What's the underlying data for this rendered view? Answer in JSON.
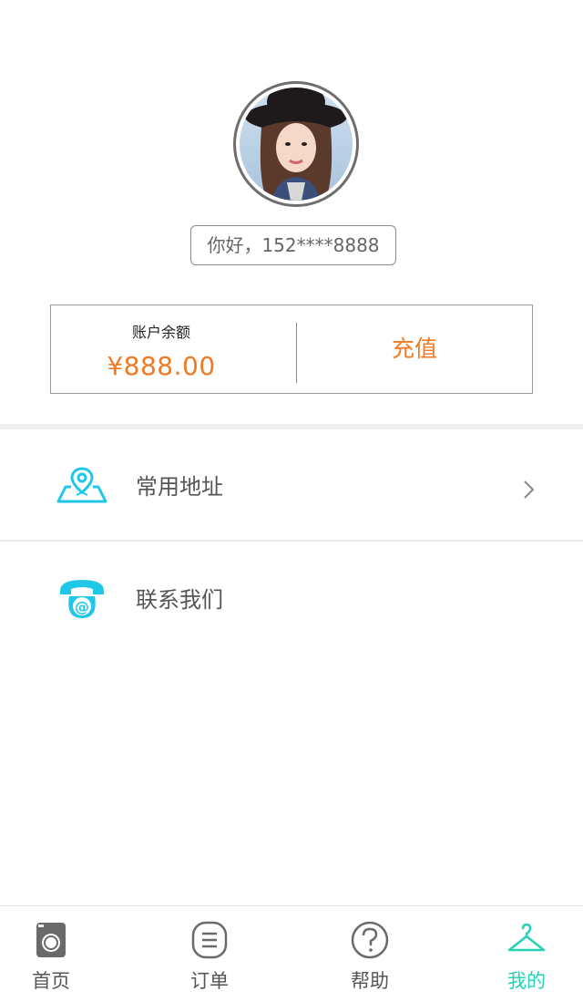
{
  "profile": {
    "greeting": "你好，152****8888"
  },
  "balance": {
    "label": "账户余额",
    "amount": "¥888.00",
    "recharge_label": "充值"
  },
  "menu": {
    "items": [
      {
        "label": "常用地址",
        "icon": "location-map-icon"
      },
      {
        "label": "联系我们",
        "icon": "phone-at-icon"
      }
    ]
  },
  "tabbar": {
    "items": [
      {
        "label": "首页",
        "icon": "washer-icon"
      },
      {
        "label": "订单",
        "icon": "order-list-icon"
      },
      {
        "label": "帮助",
        "icon": "help-icon"
      },
      {
        "label": "我的",
        "icon": "hanger-icon"
      }
    ],
    "active_index": 3
  },
  "colors": {
    "accent_orange": "#f07a22",
    "accent_cyan": "#1fc8e8",
    "accent_green": "#23d3b5"
  }
}
